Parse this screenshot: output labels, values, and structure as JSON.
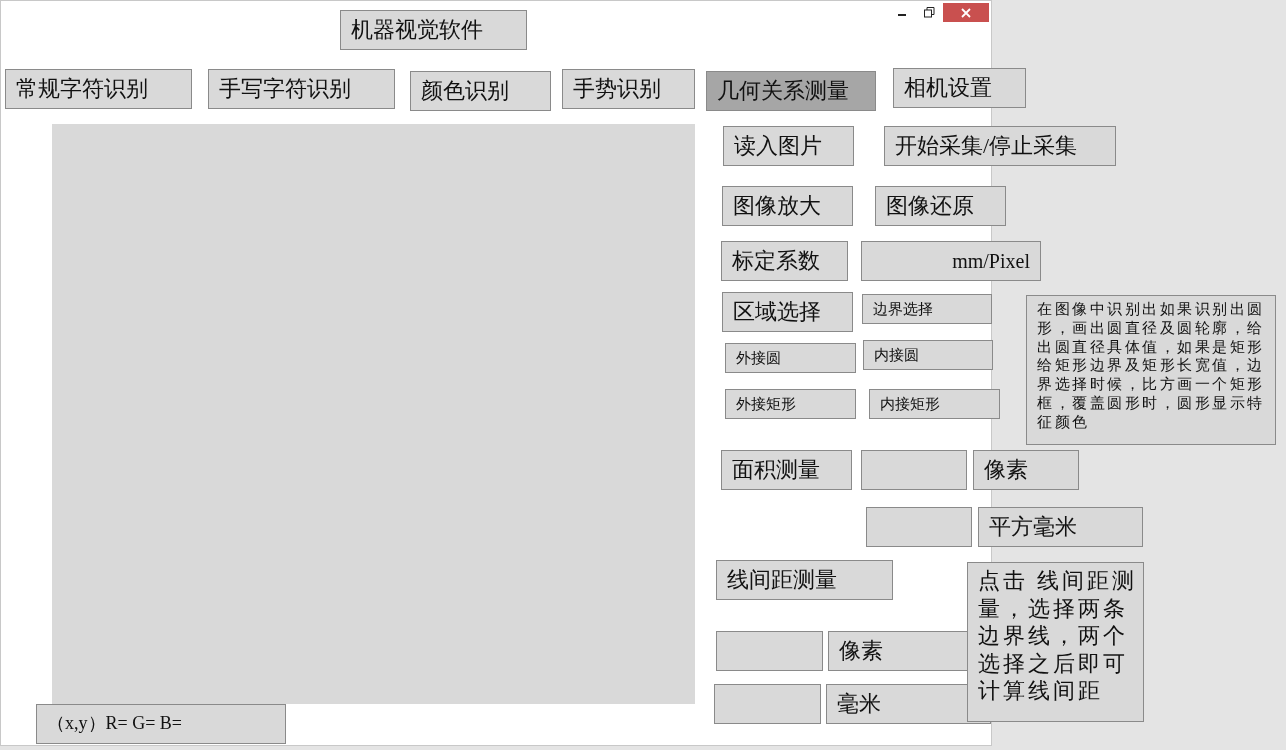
{
  "window": {
    "title": "机器视觉软件"
  },
  "tabs": [
    {
      "label": "常规字符识别",
      "selected": false
    },
    {
      "label": "手写字符识别",
      "selected": false
    },
    {
      "label": "颜色识别",
      "selected": false
    },
    {
      "label": "手势识别",
      "selected": false
    },
    {
      "label": "几何关系测量",
      "selected": true
    },
    {
      "label": "相机设置",
      "selected": false
    }
  ],
  "image_view": {
    "kind": "empty"
  },
  "controls": [
    {
      "kind": "button",
      "label": "读入图片"
    },
    {
      "kind": "button",
      "label": "开始采集/停止采集"
    },
    {
      "kind": "button",
      "label": "图像放大"
    },
    {
      "kind": "button",
      "label": "图像还原"
    },
    {
      "kind": "button",
      "label": "标定系数"
    },
    {
      "kind": "label",
      "label": "mm/Pixel"
    },
    {
      "kind": "button",
      "label": "区域选择"
    },
    {
      "kind": "button",
      "label": "边界选择"
    },
    {
      "kind": "button",
      "label": "外接圆"
    },
    {
      "kind": "button",
      "label": "内接圆"
    },
    {
      "kind": "button",
      "label": "外接矩形"
    },
    {
      "kind": "button",
      "label": "内接矩形"
    },
    {
      "kind": "note",
      "label": "在图像中识别出如果识别出圆形，画出圆直径及圆轮廓，给出圆直径具体值，如果是矩形给矩形边界及矩形长宽值，边界选择时候，比方画一个矩形框，覆盖圆形时，圆形显示特征颜色"
    },
    {
      "kind": "button",
      "label": "面积测量"
    },
    {
      "kind": "field"
    },
    {
      "kind": "label",
      "label": "像素"
    },
    {
      "kind": "field"
    },
    {
      "kind": "label",
      "label": "平方毫米"
    },
    {
      "kind": "button",
      "label": "线间距测量"
    },
    {
      "kind": "field"
    },
    {
      "kind": "label",
      "label": "像素"
    },
    {
      "kind": "field"
    },
    {
      "kind": "label",
      "label": "毫米"
    },
    {
      "kind": "note",
      "label": "点击 线间距测量，选择两条边界线，两个选择之后即可计算线间距"
    }
  ],
  "status": {
    "label": "（x,y）R=  G=  B="
  }
}
